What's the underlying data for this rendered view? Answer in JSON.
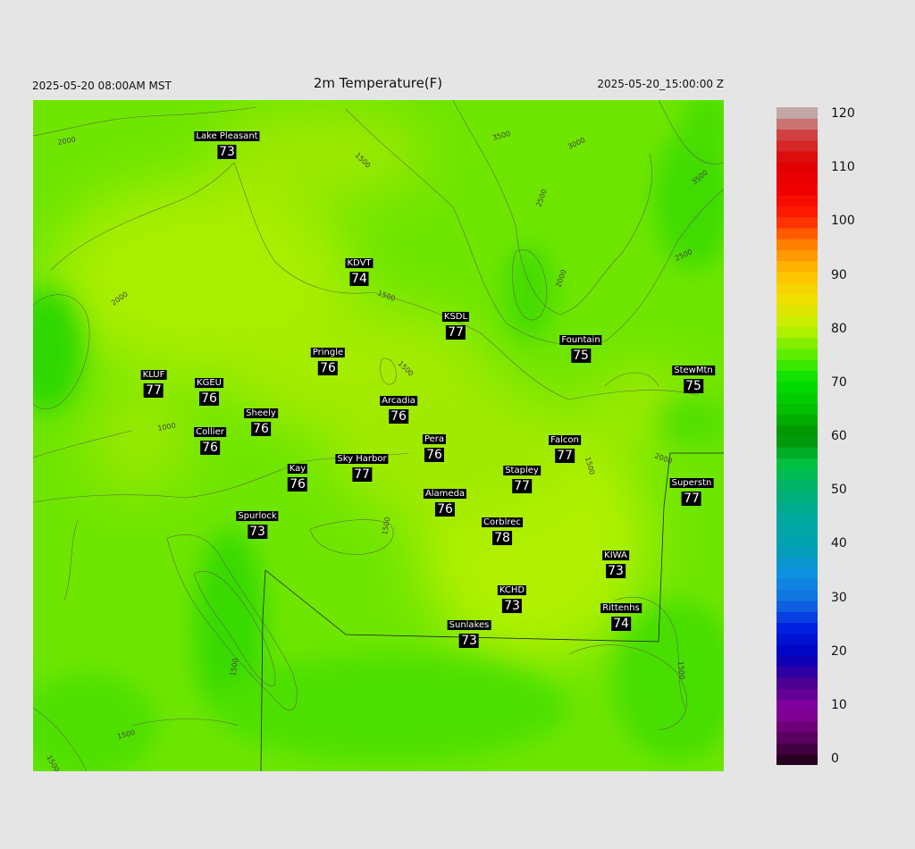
{
  "header": {
    "local_time": "2025-05-20 08:00AM MST",
    "title": "2m Temperature(F)",
    "utc_time": "2025-05-20_15:00:00 Z"
  },
  "colors": {
    "page_bg": "#e5e5e5",
    "field_base": "#6ee600",
    "field_warm": "#aef000",
    "field_cool": "#3fdc00",
    "contour": "#555555",
    "label_bg": "#000000",
    "label_fg": "#ffffff"
  },
  "contour_labels": [
    "2000",
    "1500",
    "2000",
    "3500",
    "3000",
    "3500",
    "2500",
    "2500",
    "2000",
    "1500",
    "1000",
    "1500",
    "2000",
    "1500",
    "1500",
    "1500",
    "1500",
    "1500",
    "1500"
  ],
  "stations": [
    {
      "name": "Lake Pleasant",
      "value": "73"
    },
    {
      "name": "KDVT",
      "value": "74"
    },
    {
      "name": "KSDL",
      "value": "77"
    },
    {
      "name": "Pringle",
      "value": "76"
    },
    {
      "name": "Fountain",
      "value": "75"
    },
    {
      "name": "KLUF",
      "value": "77"
    },
    {
      "name": "KGEU",
      "value": "76"
    },
    {
      "name": "StewMtn",
      "value": "75"
    },
    {
      "name": "Arcadia",
      "value": "76"
    },
    {
      "name": "Sheely",
      "value": "76"
    },
    {
      "name": "Collier",
      "value": "76"
    },
    {
      "name": "Pera",
      "value": "76"
    },
    {
      "name": "Falcon",
      "value": "77"
    },
    {
      "name": "Sky Harbor",
      "value": "77"
    },
    {
      "name": "Kay",
      "value": "76"
    },
    {
      "name": "Stapley",
      "value": "77"
    },
    {
      "name": "Superstn",
      "value": "77"
    },
    {
      "name": "Alameda",
      "value": "76"
    },
    {
      "name": "Spurlock",
      "value": "73"
    },
    {
      "name": "Corblrec",
      "value": "78"
    },
    {
      "name": "KIWA",
      "value": "73"
    },
    {
      "name": "KCHD",
      "value": "73"
    },
    {
      "name": "Rittenhs",
      "value": "74"
    },
    {
      "name": "Sunlakes",
      "value": "73"
    }
  ],
  "colorbar": {
    "ticks": [
      "120",
      "110",
      "100",
      "90",
      "80",
      "70",
      "60",
      "50",
      "40",
      "30",
      "20",
      "10",
      "0"
    ],
    "min": 0,
    "max": 120
  }
}
